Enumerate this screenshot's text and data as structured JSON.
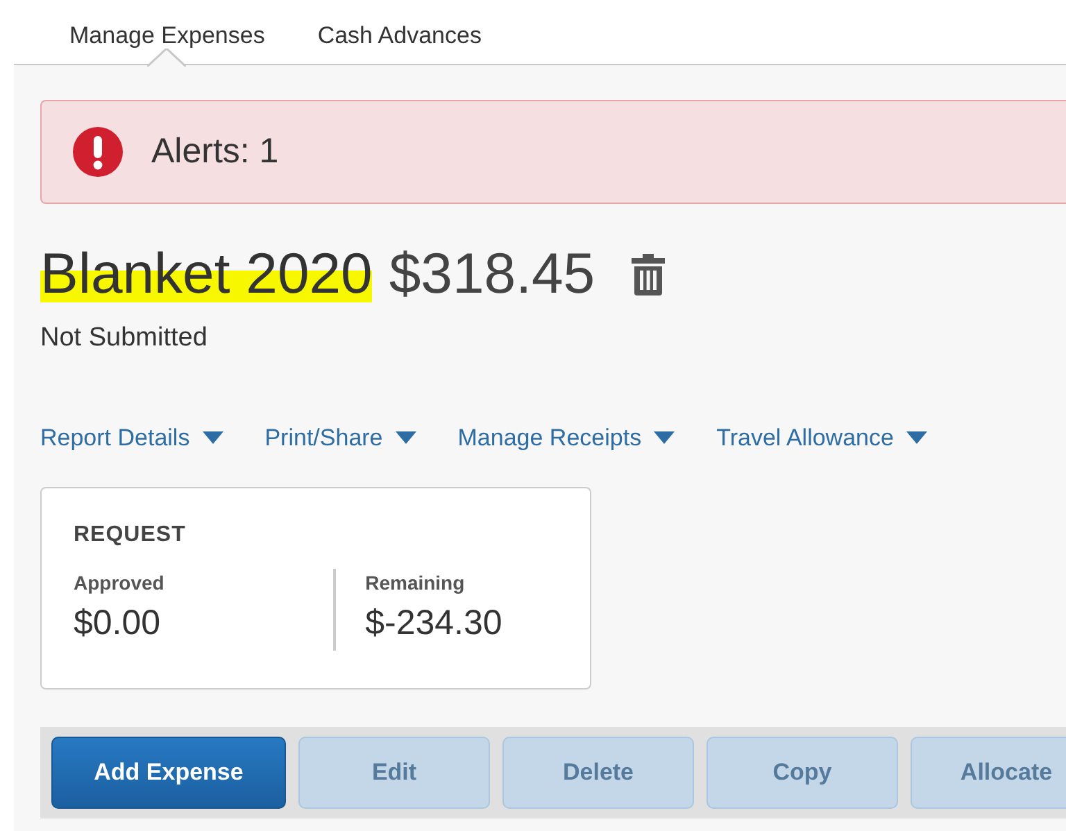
{
  "tabs": [
    {
      "label": "Manage Expenses",
      "selected": true
    },
    {
      "label": "Cash Advances",
      "selected": false
    }
  ],
  "alert": {
    "text": "Alerts: 1"
  },
  "report": {
    "name": "Blanket 2020",
    "highlighted": true,
    "amount": "$318.45",
    "status": "Not Submitted"
  },
  "menus": [
    {
      "label": "Report Details"
    },
    {
      "label": "Print/Share"
    },
    {
      "label": "Manage Receipts"
    },
    {
      "label": "Travel Allowance"
    }
  ],
  "request": {
    "title": "REQUEST",
    "figures": [
      {
        "label": "Approved",
        "value": "$0.00"
      },
      {
        "label": "Remaining",
        "value": "$-234.30"
      }
    ]
  },
  "buttons": [
    {
      "label": "Add Expense",
      "disabled": false
    },
    {
      "label": "Edit",
      "disabled": true
    },
    {
      "label": "Delete",
      "disabled": true
    },
    {
      "label": "Copy",
      "disabled": true
    },
    {
      "label": "Allocate",
      "disabled": true
    }
  ]
}
